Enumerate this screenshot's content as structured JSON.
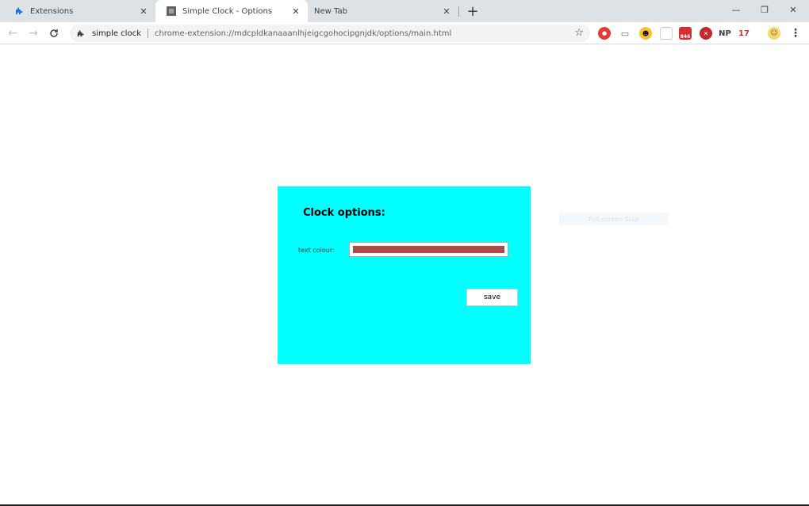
{
  "tabs": [
    {
      "title": "Extensions",
      "favicon": "puzzle-icon",
      "active": false
    },
    {
      "title": "Simple Clock - Options",
      "favicon": "clock-icon",
      "active": true
    },
    {
      "title": "New Tab",
      "favicon": "",
      "active": false
    }
  ],
  "toolbar": {
    "site_name": "simple clock",
    "url": "chrome-extension://mdcpldkanaaanlhjeigcgohocipgnjdk/options/main.html"
  },
  "extensions": {
    "np_label": "NP",
    "badge_label": "17",
    "mail_badge": "846"
  },
  "options": {
    "title": "Clock options:",
    "text_colour_label": "text colour:",
    "text_colour_value": "#b04a4a",
    "save_label": "save",
    "panel_color": "#00ffff"
  },
  "overlay": {
    "snip_label": "Full-screen Snip"
  }
}
